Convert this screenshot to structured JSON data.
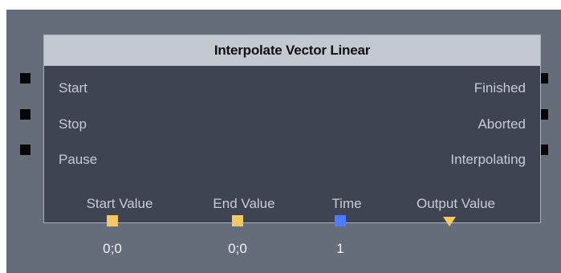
{
  "node": {
    "title": "Interpolate Vector Linear",
    "inputs": [
      {
        "label": "Start"
      },
      {
        "label": "Stop"
      },
      {
        "label": "Pause"
      }
    ],
    "outputs": [
      {
        "label": "Finished"
      },
      {
        "label": "Aborted"
      },
      {
        "label": "Interpolating"
      }
    ],
    "data_pins": [
      {
        "label": "Start Value",
        "value": "0;0",
        "color": "#f3c666"
      },
      {
        "label": "End Value",
        "value": "0;0",
        "color": "#f3c666"
      },
      {
        "label": "Time",
        "value": "1",
        "color": "#4a7dff"
      },
      {
        "label": "Output Value",
        "color": "#f3c666",
        "icon": "output-triangle-icon"
      }
    ]
  },
  "colors": {
    "canvas": "#646d79",
    "node_body": "#3e4451",
    "node_header": "#c3c8d1",
    "exec_pin": "#070707"
  }
}
